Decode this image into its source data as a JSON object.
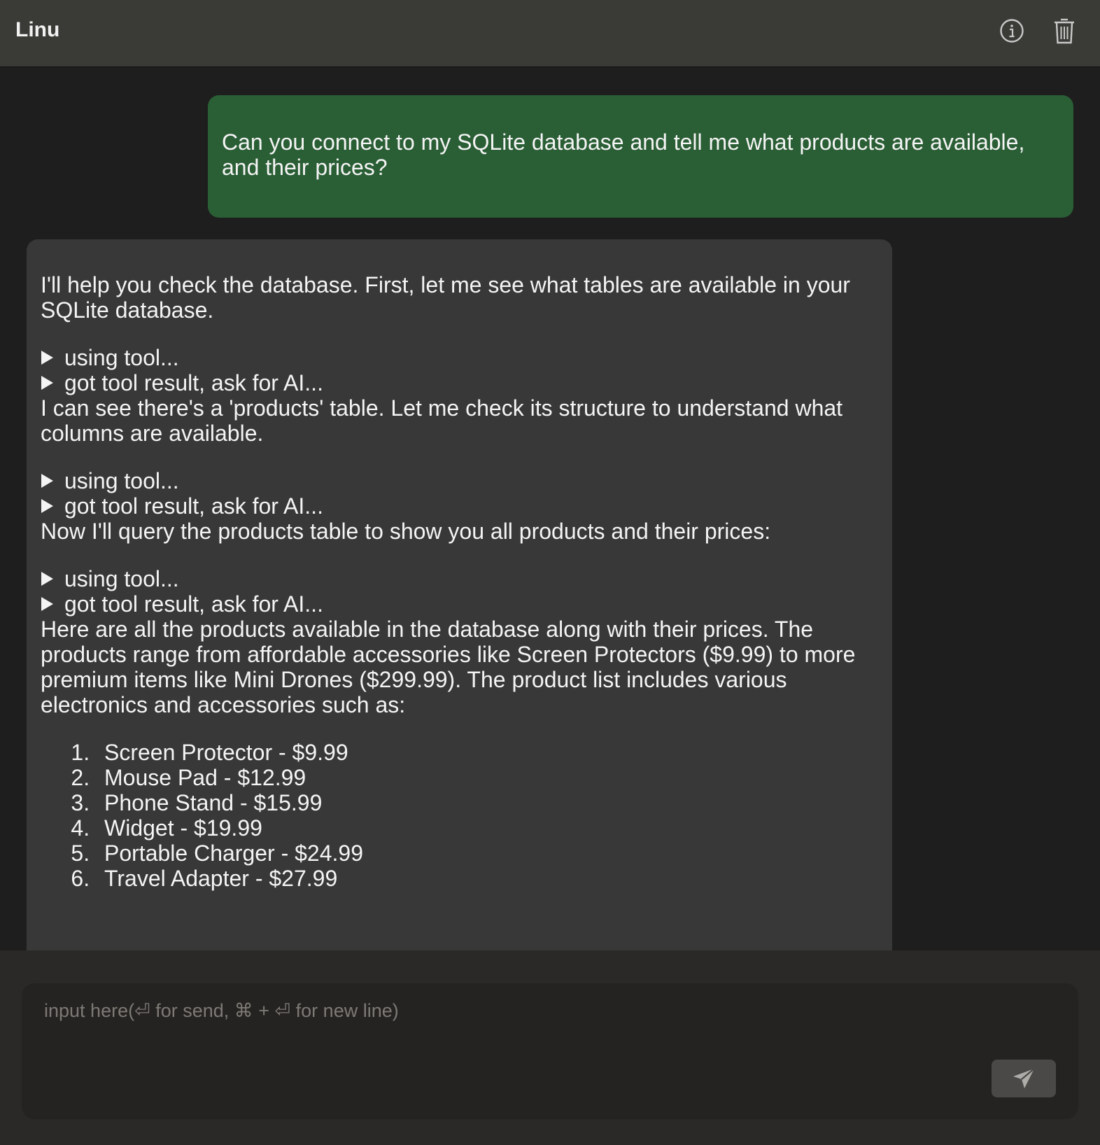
{
  "header": {
    "title": "Linu",
    "info_icon": "info-icon",
    "trash_icon": "trash-icon"
  },
  "messages": {
    "user": {
      "text": "Can you connect to my SQLite database and tell me what products are available, and their prices?"
    },
    "assistant": {
      "intro": "I'll help you check the database. First, let me see what tables are available in your SQLite database.",
      "tool_group_1": [
        "using tool...",
        "got tool result, ask for AI..."
      ],
      "step_2": "I can see there's a 'products' table. Let me check its structure to understand what columns are available.",
      "tool_group_2": [
        "using tool...",
        "got tool result, ask for AI..."
      ],
      "step_3": "Now I'll query the products table to show you all products and their prices:",
      "tool_group_3": [
        "using tool...",
        "got tool result, ask for AI..."
      ],
      "summary": "Here are all the products available in the database along with their prices. The products range from affordable accessories like Screen Protectors ($9.99) to more premium items like Mini Drones ($299.99). The product list includes various electronics and accessories such as:",
      "products": [
        "Screen Protector - $9.99",
        "Mouse Pad - $12.99",
        "Phone Stand - $15.99",
        "Widget - $19.99",
        "Portable Charger - $24.99",
        "Travel Adapter - $27.99"
      ]
    }
  },
  "composer": {
    "placeholder": "input here(⏎ for send, ⌘ + ⏎ for new line)",
    "value": "",
    "send_icon": "send-icon"
  },
  "colors": {
    "header_bg": "#3a3a37",
    "chat_bg": "#1e1e1e",
    "user_bubble": "#2a5e35",
    "assistant_bubble": "#383838",
    "composer_bg": "#252321",
    "send_button": "#4a4947"
  }
}
